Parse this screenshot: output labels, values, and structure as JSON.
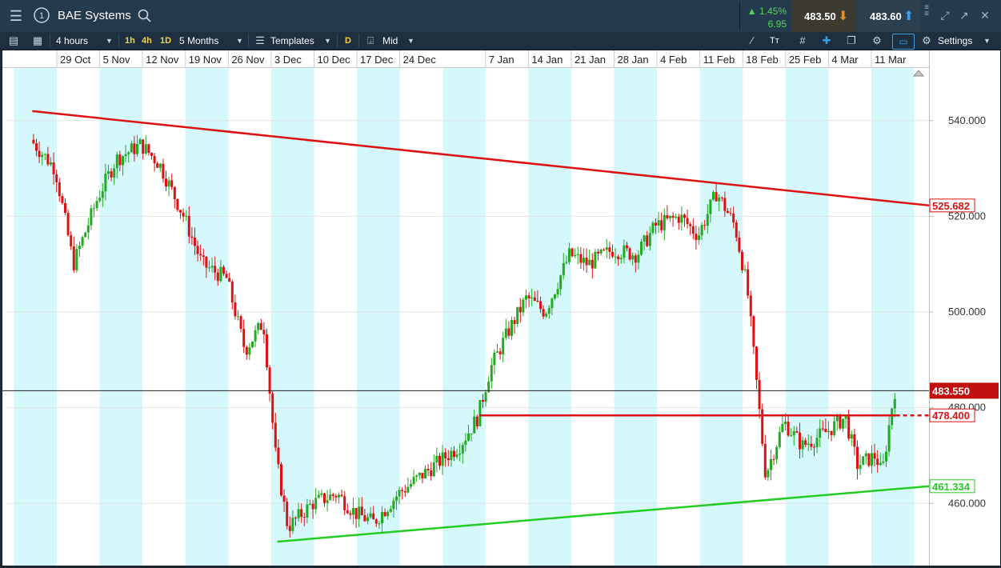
{
  "window": {
    "instrument": "BAE Systems",
    "change_pct": "▲ 1.45%",
    "change_abs": "6.95",
    "sell_price": "483.50",
    "buy_price": "483.60",
    "accent_green": "#22aa22",
    "accent_red": "#dd1111"
  },
  "toolbar": {
    "interval": "4 hours",
    "quick_1h": "1h",
    "quick_4h": "4h",
    "quick_1d": "1D",
    "range": "5 Months",
    "templates": "Templates",
    "d_marker": "D",
    "price_type": "Mid",
    "settings": "Settings",
    "text_tool": "Tᴛ"
  },
  "chart_data": {
    "type": "candlestick",
    "x_dates": [
      "29 Oct",
      "5 Nov",
      "12 Nov",
      "19 Nov",
      "26 Nov",
      "3 Dec",
      "10 Dec",
      "17 Dec",
      "24 Dec",
      "7 Jan",
      "14 Jan",
      "21 Jan",
      "28 Jan",
      "4 Feb",
      "11 Feb",
      "18 Feb",
      "25 Feb",
      "4 Mar",
      "11 Mar"
    ],
    "y_ticks": [
      460,
      480,
      500,
      520,
      540
    ],
    "y_tick_labels": [
      "460.000",
      "480.000",
      "500.000",
      "520.000",
      "540.000"
    ],
    "ylim": [
      447,
      551
    ],
    "grid": true,
    "current_price": 483.55,
    "current_price_label": "483.550",
    "trendlines": [
      {
        "name": "upper resistance",
        "color": "#dd1111",
        "from": {
          "date": "25 Oct",
          "value": 542
        },
        "to": {
          "date": "15 Mar",
          "value": 523
        },
        "tag": "525.682"
      },
      {
        "name": "horizontal resistance",
        "color": "#dd1111",
        "from": {
          "date": "6 Jan",
          "value": 478.4
        },
        "to": {
          "date": "15 Mar",
          "value": 478.4
        },
        "tag": "478.400"
      },
      {
        "name": "lower support",
        "color": "#22cc22",
        "from": {
          "date": "4 Dec",
          "value": 452
        },
        "to": {
          "date": "15 Mar",
          "value": 463
        },
        "tag": "461.334"
      }
    ],
    "price_path": [
      {
        "date": "25 Oct",
        "value": 536
      },
      {
        "date": "29 Oct",
        "value": 530
      },
      {
        "date": "1 Nov",
        "value": 510
      },
      {
        "date": "5 Nov",
        "value": 524
      },
      {
        "date": "8 Nov",
        "value": 532
      },
      {
        "date": "12 Nov",
        "value": 535
      },
      {
        "date": "15 Nov",
        "value": 531
      },
      {
        "date": "19 Nov",
        "value": 520
      },
      {
        "date": "22 Nov",
        "value": 510
      },
      {
        "date": "26 Nov",
        "value": 507
      },
      {
        "date": "29 Nov",
        "value": 492
      },
      {
        "date": "2 Dec",
        "value": 498
      },
      {
        "date": "4 Dec",
        "value": 470
      },
      {
        "date": "6 Dec",
        "value": 455
      },
      {
        "date": "10 Dec",
        "value": 460
      },
      {
        "date": "14 Dec",
        "value": 462
      },
      {
        "date": "17 Dec",
        "value": 458
      },
      {
        "date": "20 Dec",
        "value": 456
      },
      {
        "date": "24 Dec",
        "value": 462
      },
      {
        "date": "28 Dec",
        "value": 466
      },
      {
        "date": "3 Jan",
        "value": 472
      },
      {
        "date": "6 Jan",
        "value": 478
      },
      {
        "date": "8 Jan",
        "value": 488
      },
      {
        "date": "11 Jan",
        "value": 496
      },
      {
        "date": "14 Jan",
        "value": 503
      },
      {
        "date": "17 Jan",
        "value": 500
      },
      {
        "date": "21 Jan",
        "value": 512
      },
      {
        "date": "24 Jan",
        "value": 510
      },
      {
        "date": "28 Jan",
        "value": 513
      },
      {
        "date": "1 Feb",
        "value": 512
      },
      {
        "date": "4 Feb",
        "value": 518
      },
      {
        "date": "8 Feb",
        "value": 520
      },
      {
        "date": "11 Feb",
        "value": 516
      },
      {
        "date": "14 Feb",
        "value": 525
      },
      {
        "date": "17 Feb",
        "value": 518
      },
      {
        "date": "19 Feb",
        "value": 505
      },
      {
        "date": "22 Feb",
        "value": 466
      },
      {
        "date": "25 Feb",
        "value": 477
      },
      {
        "date": "28 Feb",
        "value": 472
      },
      {
        "date": "4 Mar",
        "value": 475
      },
      {
        "date": "7 Mar",
        "value": 478
      },
      {
        "date": "9 Mar",
        "value": 468
      },
      {
        "date": "12 Mar",
        "value": 470
      },
      {
        "date": "13 Mar",
        "value": 466
      },
      {
        "date": "15 Mar",
        "value": 483.55
      }
    ]
  }
}
